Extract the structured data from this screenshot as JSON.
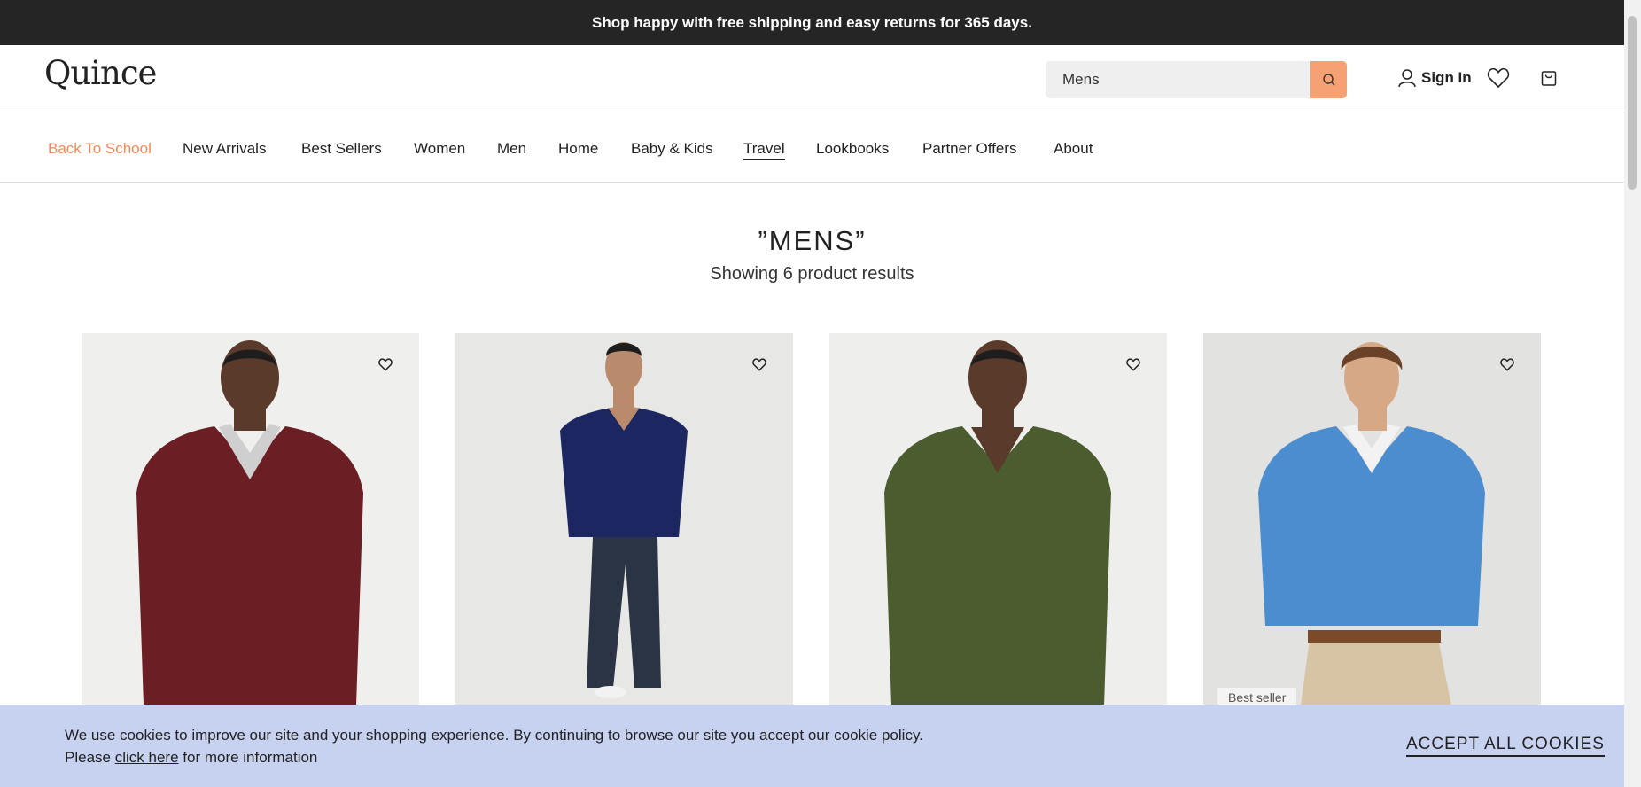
{
  "announcement": "Shop happy with free shipping and easy returns for 365 days.",
  "header": {
    "logo": "Quince",
    "search_value": "Mens",
    "sign_in": "Sign In"
  },
  "nav": [
    "Back To School",
    "New Arrivals",
    "Best Sellers",
    "Women",
    "Men",
    "Home",
    "Baby & Kids",
    "Travel",
    "Lookbooks",
    "Partner Offers",
    "About"
  ],
  "results": {
    "title": "”MENS”",
    "count": "Showing 6 product results"
  },
  "products": [
    {
      "color": "#6b1f24",
      "badge": ""
    },
    {
      "color": "#1c2660",
      "badge": ""
    },
    {
      "color": "#4b5c2f",
      "badge": ""
    },
    {
      "color": "#4c8dd0",
      "badge": "Best seller"
    }
  ],
  "cookie": {
    "line1": "We use cookies to improve our site and your shopping experience. By continuing to browse our site you accept our cookie policy.",
    "line2_pre": "Please",
    "link": "click here",
    "line2_post": "for more information",
    "accept": "ACCEPT ALL COOKIES"
  },
  "colors": {
    "accent": "#ef8a5a",
    "search_button": "#f6a173",
    "cookie_bg": "#c7d1f0"
  }
}
